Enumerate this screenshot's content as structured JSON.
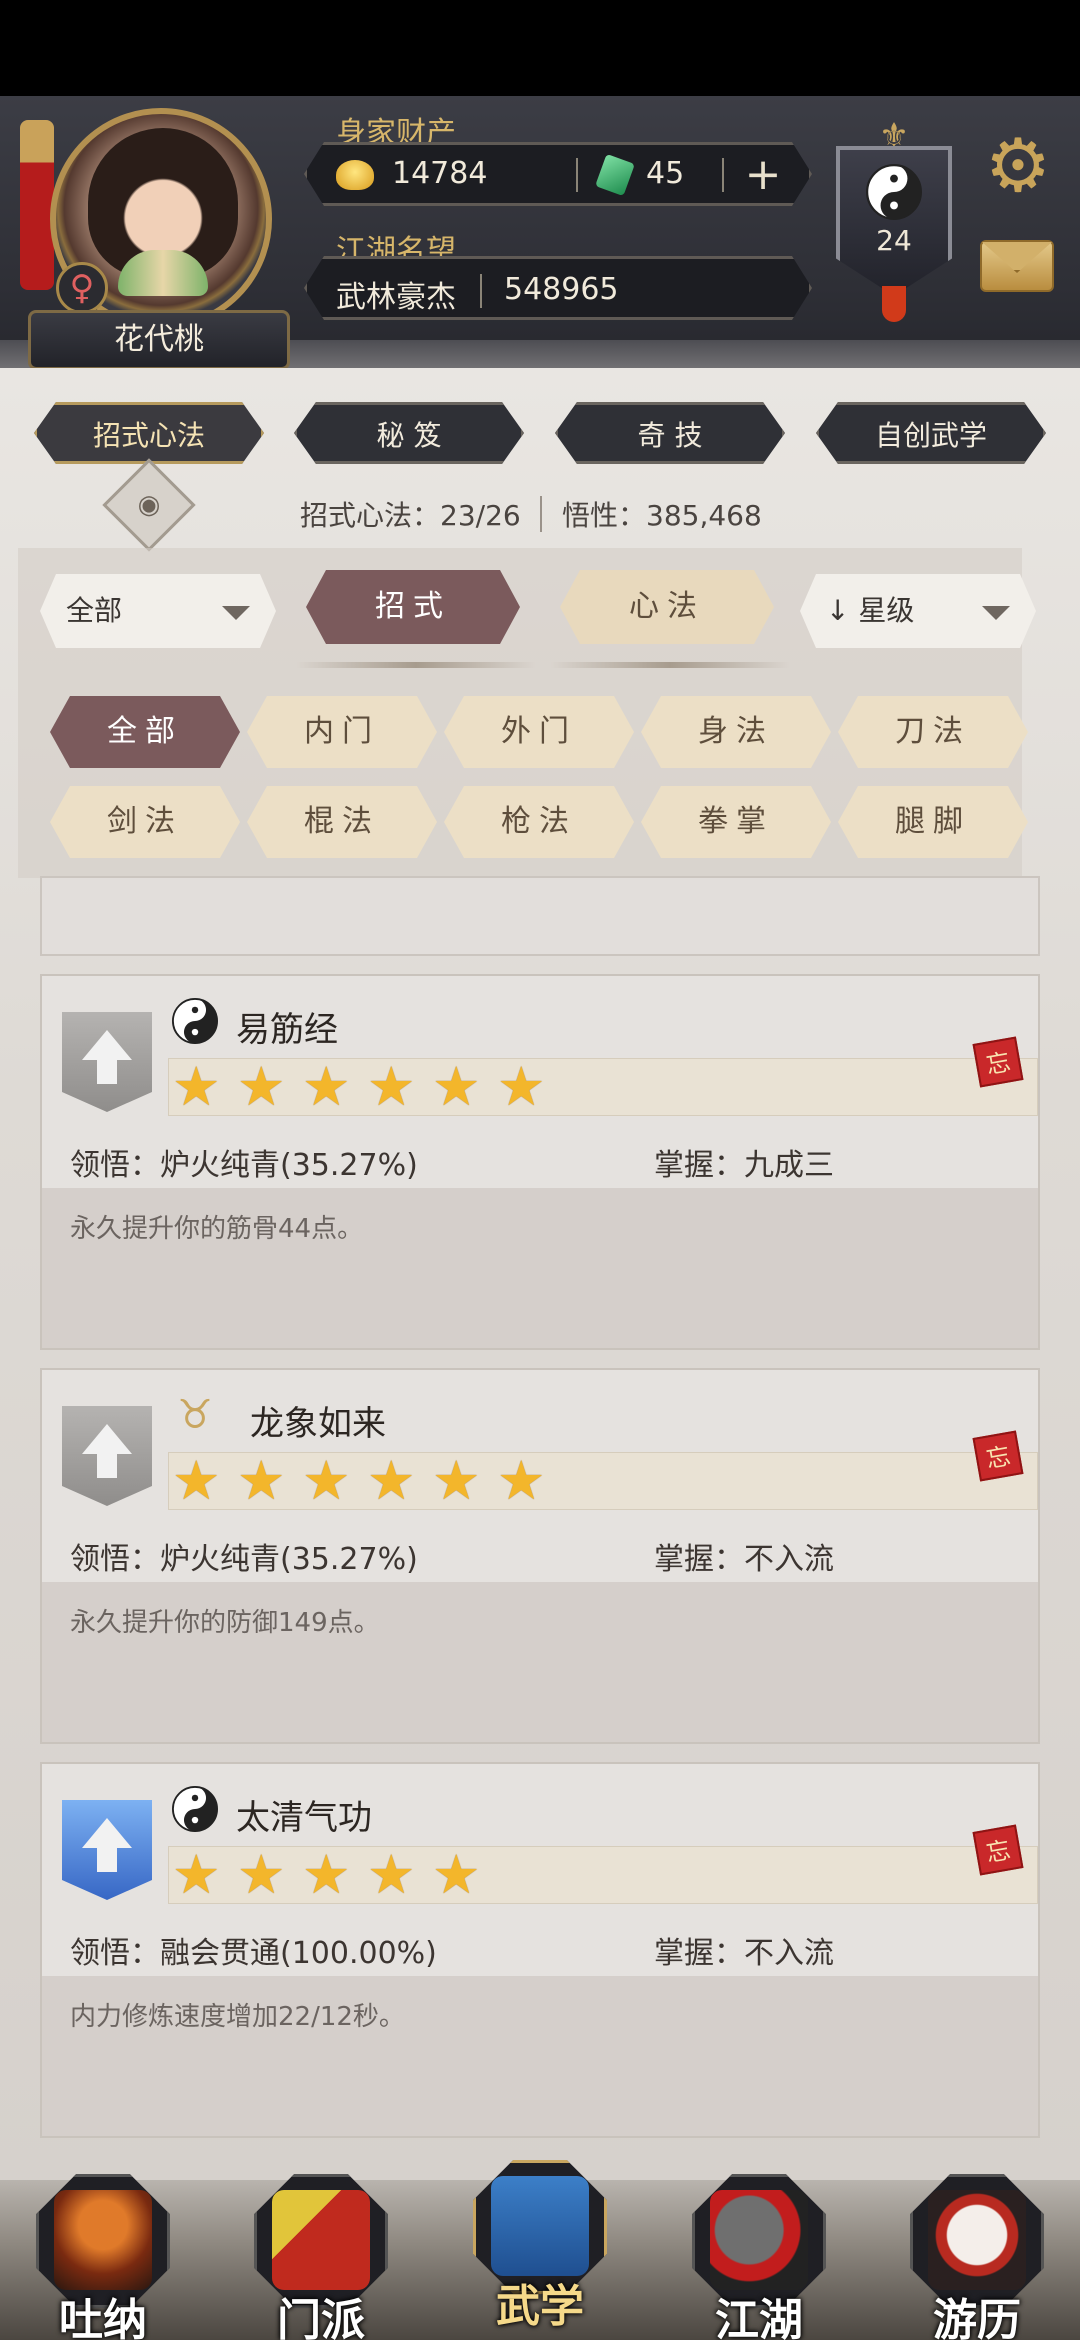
{
  "header": {
    "wealth_label": "身家财产",
    "gold": "14784",
    "jade": "45",
    "plus": "+",
    "fame_label": "江湖名望",
    "fame_title": "武林豪杰",
    "fame_value": "548965",
    "player_name": "花代桃",
    "gender_symbol": "♀",
    "level": "24"
  },
  "top_tabs": [
    {
      "label": "招式心法",
      "active": true
    },
    {
      "label": "秘 笈",
      "active": false
    },
    {
      "label": "奇 技",
      "active": false
    },
    {
      "label": "自创武学",
      "active": false
    }
  ],
  "stats": {
    "moves": "招式心法：23/26",
    "insight": "悟性：385,468"
  },
  "filters": {
    "category_dropdown": "全部",
    "segment_moves": "招式",
    "segment_mental": "心法",
    "sort_dropdown": "星级",
    "sort_arrow": "↓",
    "chips": [
      "全部",
      "内门",
      "外门",
      "身法",
      "刀法",
      "剑法",
      "棍法",
      "枪法",
      "拳掌",
      "腿脚"
    ]
  },
  "cards": [
    {
      "name": "易筋经",
      "stars": 6,
      "insight": "领悟：炉火纯青(35.27%)",
      "mastery": "掌握：九成三",
      "desc": "永久提升你的筋骨44点。",
      "rank_color": "grey",
      "forget": "忘"
    },
    {
      "name": "龙象如来",
      "stars": 6,
      "insight": "领悟：炉火纯青(35.27%)",
      "mastery": "掌握：不入流",
      "desc": "永久提升你的防御149点。",
      "rank_color": "grey",
      "forget": "忘"
    },
    {
      "name": "太清气功",
      "stars": 5,
      "insight": "领悟：融会贯通(100.00%)",
      "mastery": "掌握：不入流",
      "desc": "内力修炼速度增加22/12秒。",
      "rank_color": "blue",
      "forget": "忘"
    }
  ],
  "bottom_nav": [
    "吐纳",
    "门派",
    "武学",
    "江湖",
    "游历"
  ],
  "colors": {
    "accent_active": "#7b5a5c",
    "gold_label": "#d7b66a",
    "star": "#f3b62b"
  }
}
